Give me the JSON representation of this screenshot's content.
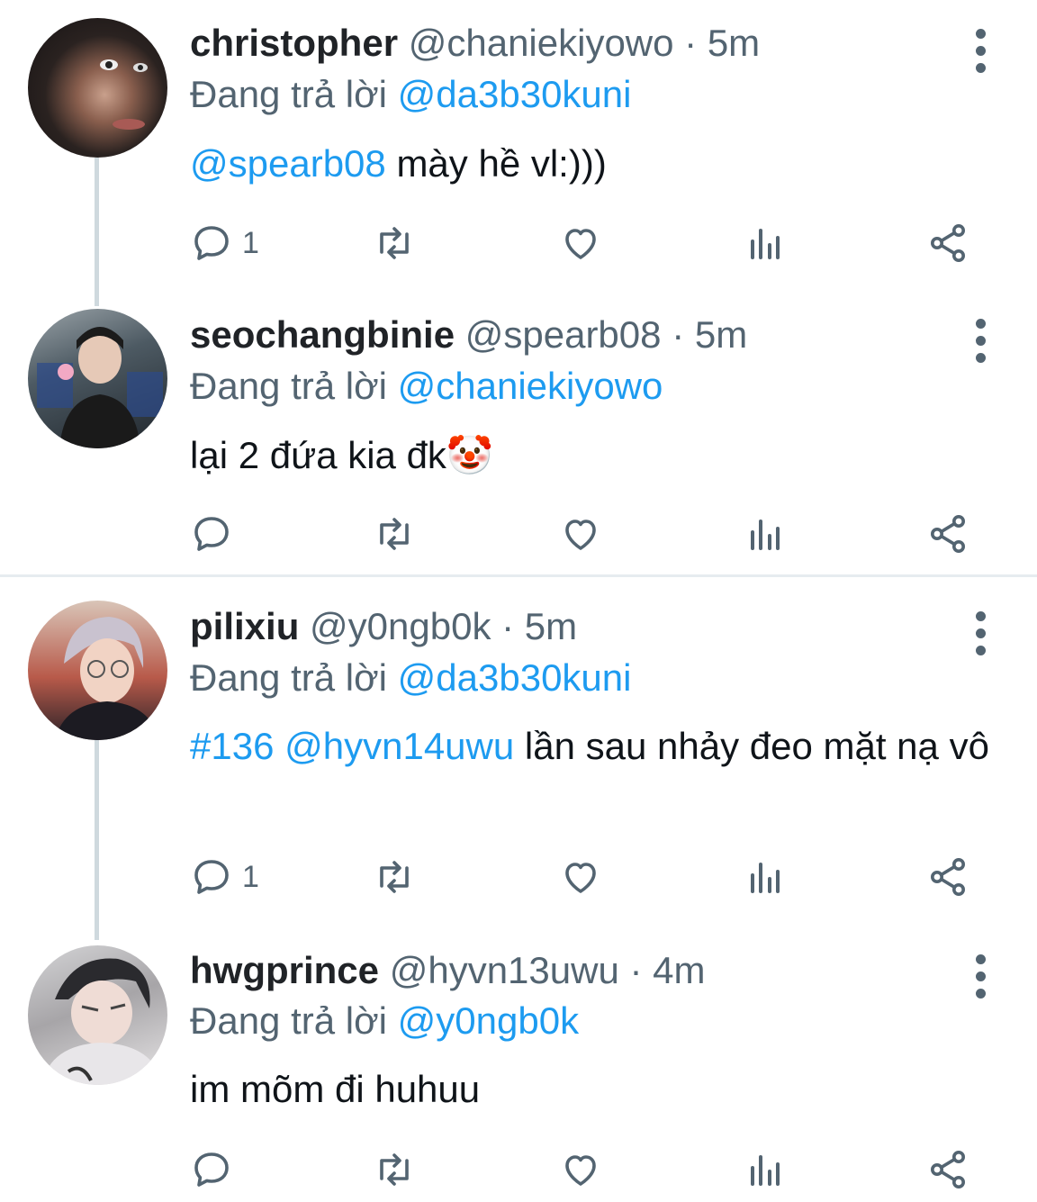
{
  "tweets": [
    {
      "name": "christopher",
      "handle": "@chaniekiyowo",
      "time": "· 5m",
      "reply_prefix": "Đang trả lời",
      "reply_to": "@da3b30kuni",
      "mention": "@spearb08",
      "text": " mày hề vl:)))",
      "reply_count": "1"
    },
    {
      "name": "seochangbinie",
      "handle": "@spearb08",
      "time": "· 5m",
      "reply_prefix": "Đang trả lời",
      "reply_to": "@chaniekiyowo",
      "text": "lại 2 đứa kia đk🤡",
      "reply_count": ""
    },
    {
      "name": "pilixiu",
      "handle": "@y0ngb0k",
      "time": "· 5m",
      "reply_prefix": "Đang trả lời",
      "reply_to": "@da3b30kuni",
      "hashtag": "#136",
      "mention": "@hyvn14uwu",
      "text": " lần sau nhảy đeo mặt nạ vô",
      "reply_count": "1"
    },
    {
      "name": "hwgprince",
      "handle": "@hyvn13uwu",
      "time": "· 4m",
      "reply_prefix": "Đang trả lời",
      "reply_to": "@y0ngb0k",
      "text": "im mõm đi huhuu",
      "reply_count": ""
    }
  ],
  "colors": {
    "accent": "#1d9bf0",
    "secondary_text": "#536471",
    "primary_text": "#0f1419",
    "thread_line": "#cfd9de"
  },
  "icons": [
    "reply-icon",
    "retweet-icon",
    "like-icon",
    "views-icon",
    "share-icon",
    "more-icon"
  ]
}
